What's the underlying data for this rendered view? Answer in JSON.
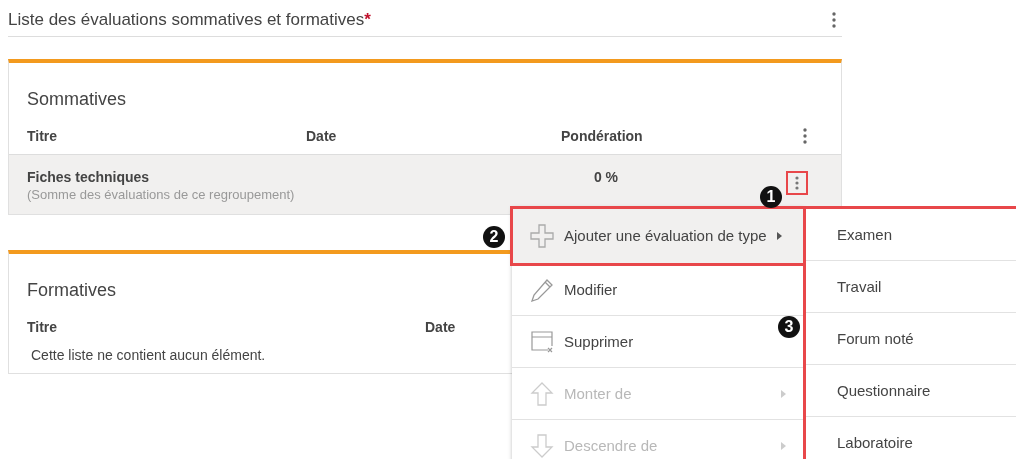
{
  "title": "Liste des évaluations sommatives et formatives",
  "required_mark": "*",
  "sections": [
    {
      "title": "Sommatives",
      "columns": [
        "Titre",
        "Date",
        "Pondération"
      ],
      "rows": [
        {
          "title": "Fiches techniques",
          "subtitle": "(Somme des évaluations de ce regroupement)",
          "weight": "0 %",
          "selected": true
        }
      ]
    },
    {
      "title": "Formatives",
      "columns": [
        "Titre",
        "Date"
      ],
      "empty_text": "Cette liste ne contient aucun élément."
    }
  ],
  "menu": [
    {
      "kind": "add",
      "label": "Ajouter une évaluation de type",
      "submenu": true,
      "disabled": false,
      "selected": true
    },
    {
      "kind": "edit",
      "label": "Modifier",
      "submenu": false,
      "disabled": false,
      "selected": false
    },
    {
      "kind": "delete",
      "label": "Supprimer",
      "submenu": false,
      "disabled": false,
      "selected": false
    },
    {
      "kind": "up",
      "label": "Monter de",
      "submenu": true,
      "disabled": true,
      "selected": false
    },
    {
      "kind": "down",
      "label": "Descendre de",
      "submenu": true,
      "disabled": true,
      "selected": false
    }
  ],
  "submenu": [
    "Examen",
    "Travail",
    "Forum noté",
    "Questionnaire",
    "Laboratoire"
  ],
  "callouts": [
    "1",
    "2",
    "3"
  ]
}
